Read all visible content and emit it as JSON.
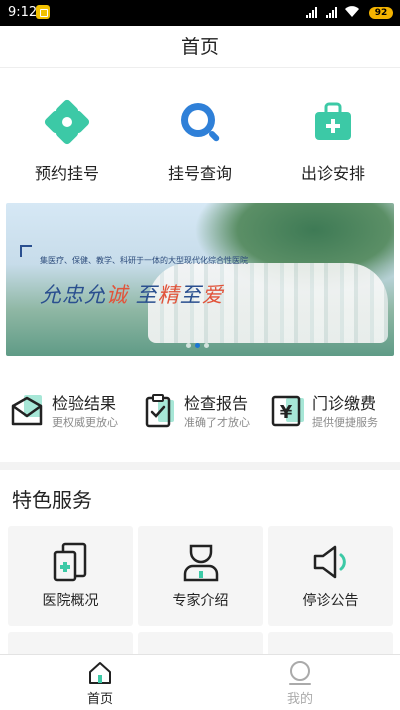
{
  "status_bar": {
    "time": "9:12",
    "battery": "92"
  },
  "header": {
    "title": "首页"
  },
  "quick_actions": [
    {
      "label": "预约挂号",
      "icon": "clover-icon"
    },
    {
      "label": "挂号查询",
      "icon": "search-icon"
    },
    {
      "label": "出诊安排",
      "icon": "medical-bag-icon"
    }
  ],
  "banner": {
    "tagline": "集医疗、保健、教学、科研于一体的大型现代化综合性医院",
    "slogan_parts": [
      "允忠允",
      "诚",
      "  至",
      "精",
      "至",
      "爱"
    ],
    "pages": 3,
    "active_page": 1
  },
  "services": [
    {
      "title": "检验结果",
      "subtitle": "更权威更放心",
      "icon": "envelope-report-icon"
    },
    {
      "title": "检查报告",
      "subtitle": "准确了才放心",
      "icon": "clipboard-check-icon"
    },
    {
      "title": "门诊缴费",
      "subtitle": "提供便捷服务",
      "icon": "yen-payment-icon"
    }
  ],
  "features": {
    "title": "特色服务",
    "items": [
      {
        "label": "医院概况",
        "icon": "building-icon"
      },
      {
        "label": "专家介绍",
        "icon": "doctor-icon"
      },
      {
        "label": "停诊公告",
        "icon": "megaphone-icon"
      }
    ]
  },
  "tabbar": [
    {
      "label": "首页",
      "icon": "home-icon",
      "active": true
    },
    {
      "label": "我的",
      "icon": "profile-icon",
      "active": false
    }
  ],
  "colors": {
    "accent": "#3cc9a6",
    "blue": "#1b76d3",
    "brand_red": "#e1533a"
  }
}
